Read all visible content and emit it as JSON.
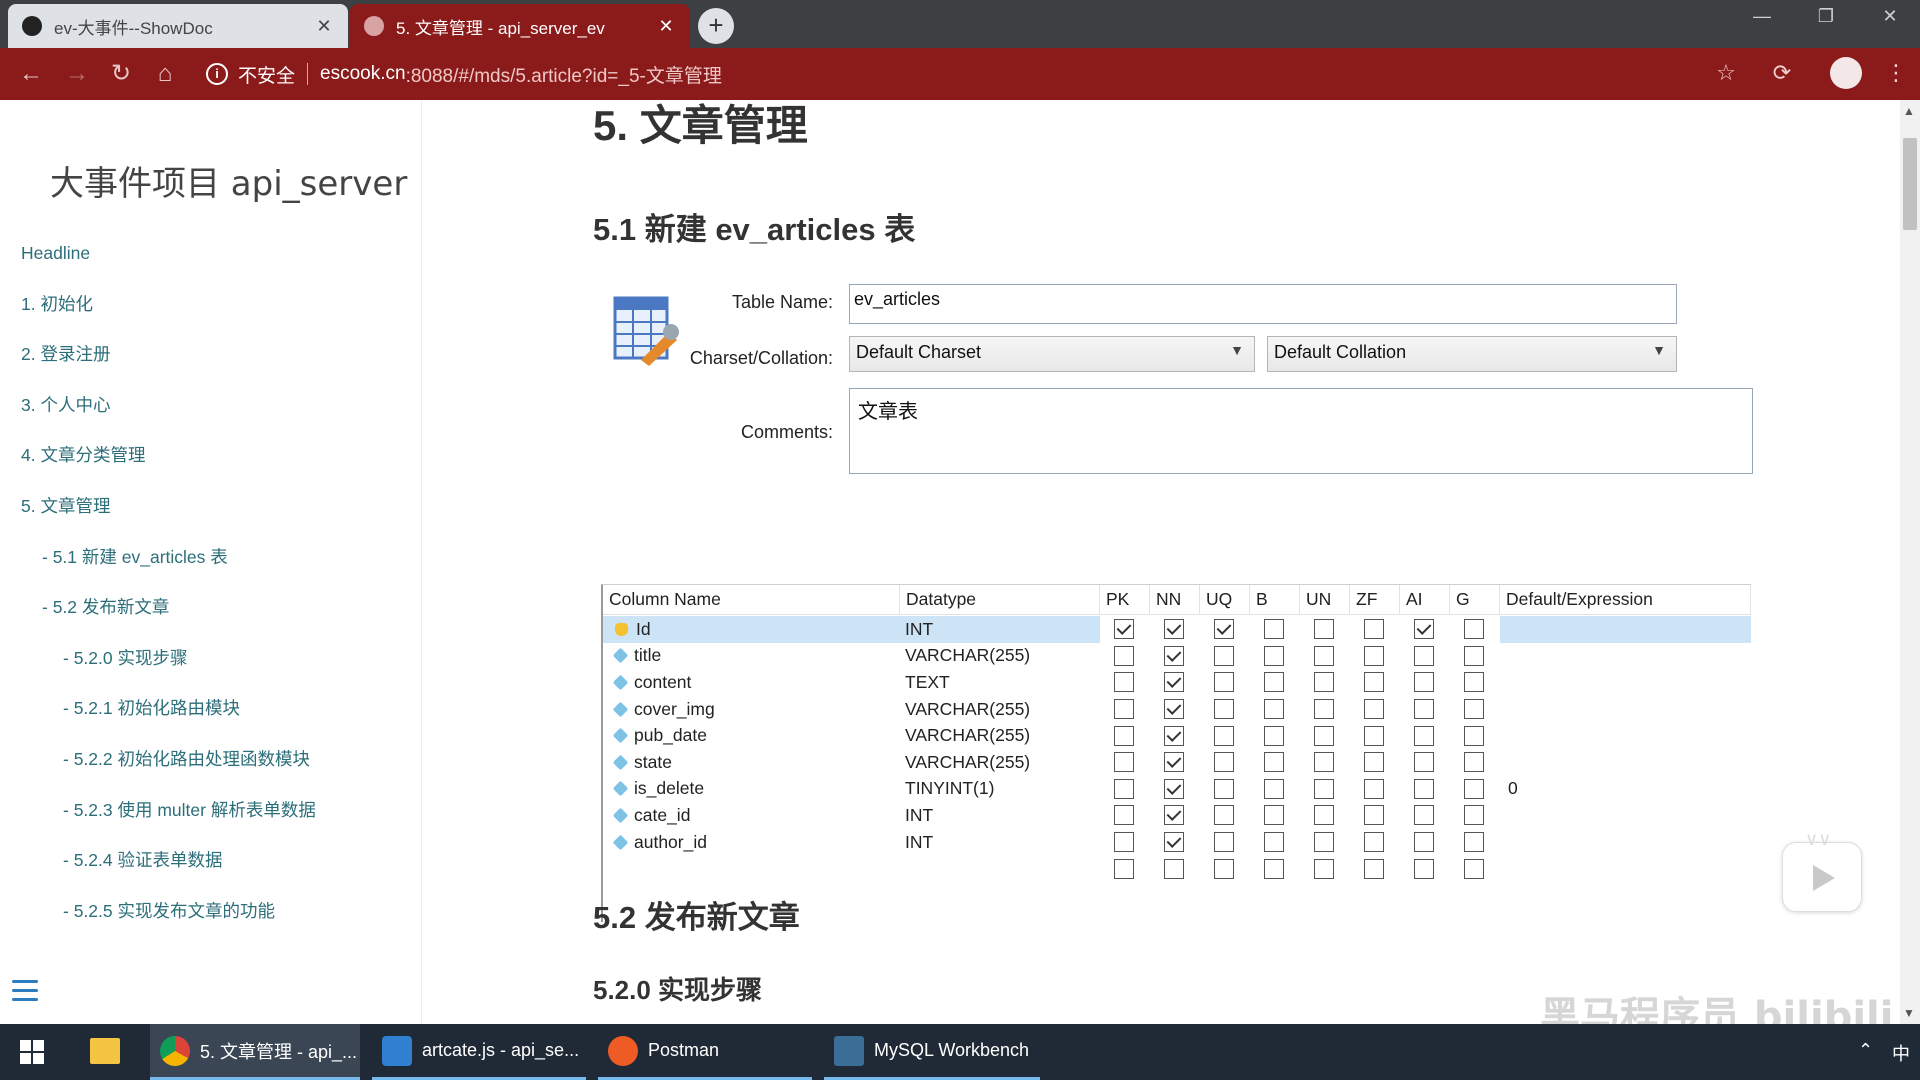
{
  "browser": {
    "tabs": [
      {
        "title": "ev-大事件--ShowDoc",
        "active": false
      },
      {
        "title": "5. 文章管理 - api_server_ev",
        "active": true
      }
    ],
    "security_label": "不安全",
    "url_host": "escook.cn",
    "url_path": ":8088/#/mds/5.article?id=_5-文章管理",
    "theme_color": "#8b1a1a"
  },
  "sidebar": {
    "title": "大事件项目 api_server",
    "items": [
      {
        "label": "Headline",
        "level": 0
      },
      {
        "label": "1. 初始化",
        "level": 0
      },
      {
        "label": "2. 登录注册",
        "level": 0
      },
      {
        "label": "3. 个人中心",
        "level": 0
      },
      {
        "label": "4. 文章分类管理",
        "level": 0
      },
      {
        "label": "5. 文章管理",
        "level": 0
      },
      {
        "label": "- 5.1 新建 ev_articles 表",
        "level": 1
      },
      {
        "label": "- 5.2 发布新文章",
        "level": 1
      },
      {
        "label": "- 5.2.0 实现步骤",
        "level": 2
      },
      {
        "label": "- 5.2.1 初始化路由模块",
        "level": 2
      },
      {
        "label": "- 5.2.2 初始化路由处理函数模块",
        "level": 2
      },
      {
        "label": "- 5.2.3 使用 multer 解析表单数据",
        "level": 2
      },
      {
        "label": "- 5.2.4 验证表单数据",
        "level": 2
      },
      {
        "label": "- 5.2.5 实现发布文章的功能",
        "level": 2
      }
    ]
  },
  "content": {
    "h1": "5. 文章管理",
    "h2_create": "5.1 新建 ev_articles 表",
    "h2_publish": "5.2 发布新文章",
    "h3_steps": "5.2.0 实现步骤"
  },
  "workbench": {
    "table_name_label": "Table Name:",
    "table_name": "ev_articles",
    "charset_label": "Charset/Collation:",
    "charset": "Default Charset",
    "collation": "Default Collation",
    "comments_label": "Comments:",
    "comments": "文章表",
    "headers": [
      "Column Name",
      "Datatype",
      "PK",
      "NN",
      "UQ",
      "B",
      "UN",
      "ZF",
      "AI",
      "G",
      "Default/Expression"
    ],
    "rows": [
      {
        "name": "Id",
        "type": "INT",
        "flags": [
          true,
          true,
          true,
          false,
          false,
          false,
          true,
          false
        ],
        "default": "",
        "pk": true
      },
      {
        "name": "title",
        "type": "VARCHAR(255)",
        "flags": [
          false,
          true,
          false,
          false,
          false,
          false,
          false,
          false
        ],
        "default": ""
      },
      {
        "name": "content",
        "type": "TEXT",
        "flags": [
          false,
          true,
          false,
          false,
          false,
          false,
          false,
          false
        ],
        "default": ""
      },
      {
        "name": "cover_img",
        "type": "VARCHAR(255)",
        "flags": [
          false,
          true,
          false,
          false,
          false,
          false,
          false,
          false
        ],
        "default": ""
      },
      {
        "name": "pub_date",
        "type": "VARCHAR(255)",
        "flags": [
          false,
          true,
          false,
          false,
          false,
          false,
          false,
          false
        ],
        "default": ""
      },
      {
        "name": "state",
        "type": "VARCHAR(255)",
        "flags": [
          false,
          true,
          false,
          false,
          false,
          false,
          false,
          false
        ],
        "default": ""
      },
      {
        "name": "is_delete",
        "type": "TINYINT(1)",
        "flags": [
          false,
          true,
          false,
          false,
          false,
          false,
          false,
          false
        ],
        "default": "0"
      },
      {
        "name": "cate_id",
        "type": "INT",
        "flags": [
          false,
          true,
          false,
          false,
          false,
          false,
          false,
          false
        ],
        "default": ""
      },
      {
        "name": "author_id",
        "type": "INT",
        "flags": [
          false,
          true,
          false,
          false,
          false,
          false,
          false,
          false
        ],
        "default": ""
      },
      {
        "name": "",
        "type": "",
        "flags": [
          false,
          false,
          false,
          false,
          false,
          false,
          false,
          false
        ],
        "default": ""
      }
    ]
  },
  "overlay": {
    "watermark": "黑马程序员 bilibili"
  },
  "taskbar": {
    "items": [
      {
        "label": "5. 文章管理 - api_...",
        "icon": "chrome-icon",
        "color": "#4285f4"
      },
      {
        "label": "artcate.js - api_se...",
        "icon": "vscode-icon",
        "color": "#2f80d1"
      },
      {
        "label": "Postman",
        "icon": "postman-icon",
        "color": "#ef5b25"
      },
      {
        "label": "MySQL Workbench",
        "icon": "mysql-workbench-icon",
        "color": "#3b6e96"
      }
    ],
    "ime": "中"
  }
}
